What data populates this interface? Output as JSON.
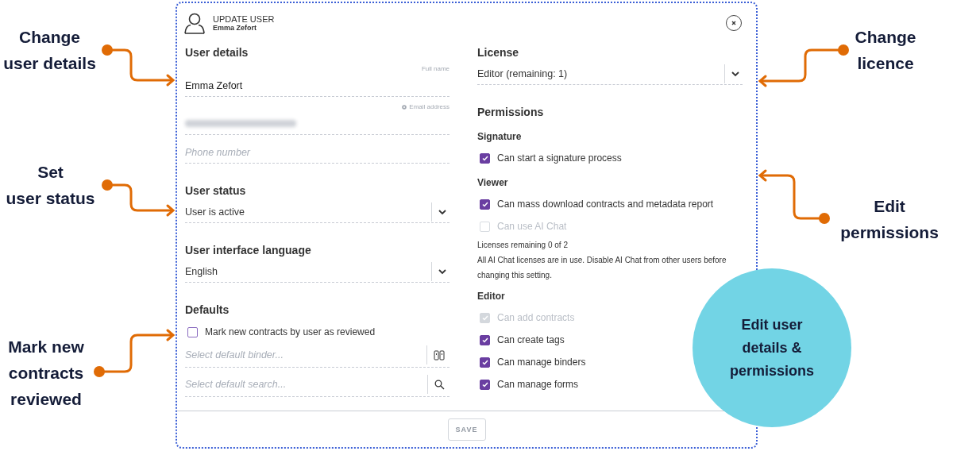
{
  "dialog": {
    "title": "UPDATE USER",
    "subtitle": "Emma Zefort",
    "left": [
      {
        "kind": "heading",
        "text": "User details"
      },
      {
        "kind": "text",
        "label": "Full name",
        "value": "Emma Zefort",
        "label_icon": false
      },
      {
        "kind": "text",
        "label": "Email address",
        "label_icon": true,
        "value_hidden": true
      },
      {
        "kind": "text",
        "placeholder": "Phone number"
      },
      {
        "kind": "heading",
        "text": "User status"
      },
      {
        "kind": "select",
        "value": "User is active"
      },
      {
        "kind": "heading",
        "text": "User interface language"
      },
      {
        "kind": "select",
        "value": "English"
      },
      {
        "kind": "heading",
        "text": "Defaults"
      },
      {
        "kind": "checkbox",
        "label": "Mark new contracts by user as reviewed",
        "checked": false,
        "disabled": false
      },
      {
        "kind": "binder_picker",
        "placeholder": "Select default binder..."
      },
      {
        "kind": "search_picker",
        "placeholder": "Select default search..."
      }
    ],
    "right": [
      {
        "kind": "heading",
        "text": "License"
      },
      {
        "kind": "select",
        "value": "Editor (remaining: 1)"
      },
      {
        "kind": "heading",
        "text": "Permissions"
      },
      {
        "kind": "subheading",
        "text": "Signature"
      },
      {
        "kind": "checkbox",
        "label": "Can start a signature process",
        "checked": true,
        "disabled": false
      },
      {
        "kind": "subheading",
        "text": "Viewer"
      },
      {
        "kind": "checkbox",
        "label": "Can mass download contracts and metadata report",
        "checked": true,
        "disabled": false
      },
      {
        "kind": "checkbox",
        "label": "Can use AI Chat",
        "checked": false,
        "disabled": true
      },
      {
        "kind": "note",
        "text": "Licenses remaining 0 of 2"
      },
      {
        "kind": "note",
        "text": "All AI Chat licenses are in use. Disable AI Chat from other users before changing this setting."
      },
      {
        "kind": "subheading",
        "text": "Editor"
      },
      {
        "kind": "checkbox",
        "label": "Can add contracts",
        "checked": true,
        "disabled": true
      },
      {
        "kind": "checkbox",
        "label": "Can create tags",
        "checked": true,
        "disabled": false
      },
      {
        "kind": "checkbox",
        "label": "Can manage binders",
        "checked": true,
        "disabled": false
      },
      {
        "kind": "checkbox",
        "label": "Can manage forms",
        "checked": true,
        "disabled": false
      }
    ],
    "save_button": {
      "label": "SAVE",
      "disabled": true
    }
  },
  "annotations": [
    {
      "lines": [
        "Change",
        "user details"
      ]
    },
    {
      "lines": [
        "Set",
        "user status"
      ]
    },
    {
      "lines": [
        "Mark new",
        "contracts",
        "reviewed"
      ]
    },
    {
      "lines": [
        "Change",
        "licence"
      ]
    },
    {
      "lines": [
        "Edit",
        "permissions"
      ]
    }
  ],
  "callout": {
    "lines": [
      "Edit user",
      "details &",
      "permissions"
    ]
  }
}
